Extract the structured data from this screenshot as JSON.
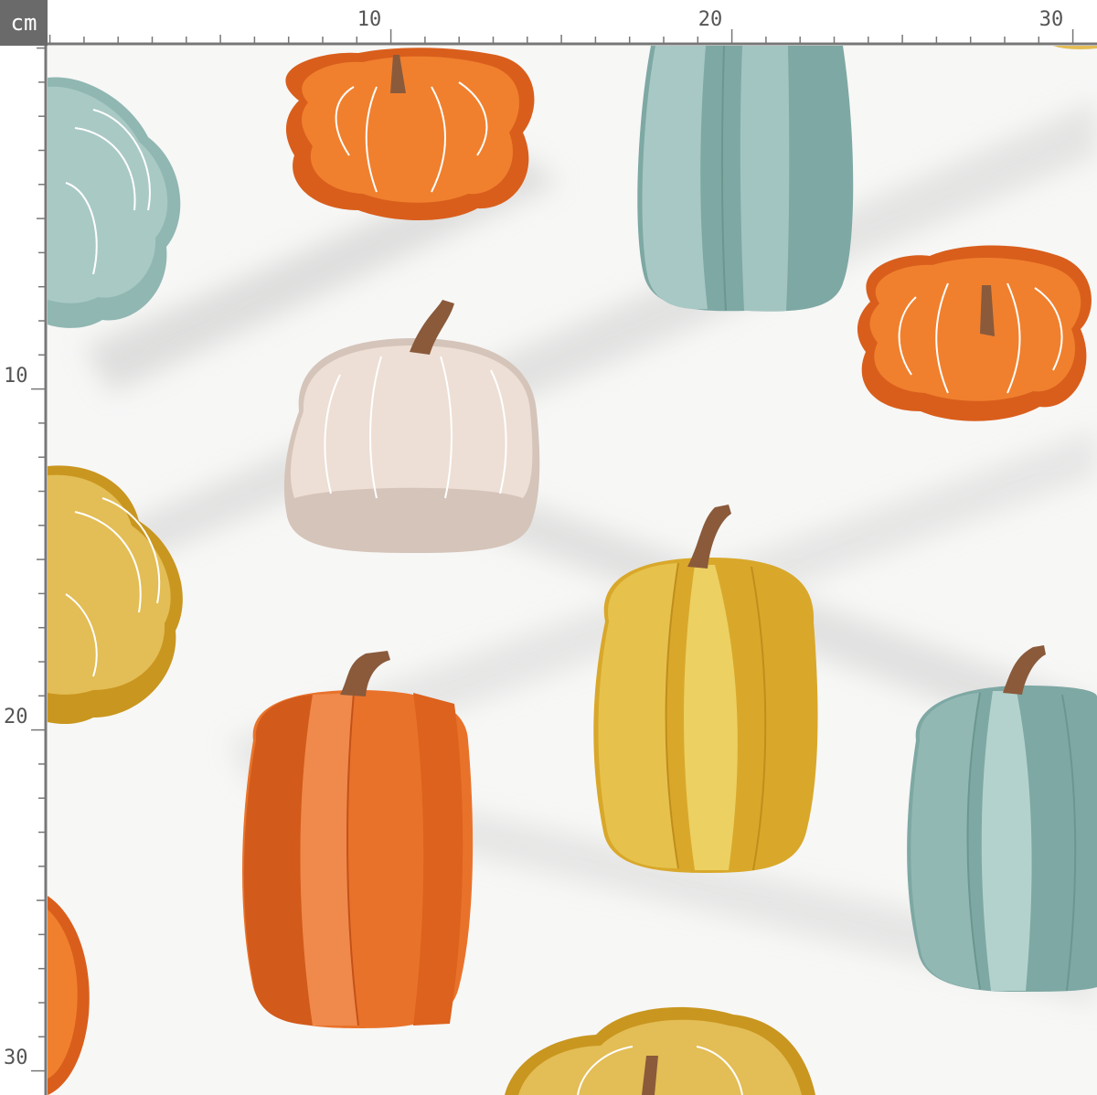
{
  "ruler": {
    "unit_label": "cm",
    "top_labels": [
      "10",
      "20",
      "30"
    ],
    "left_labels": [
      "10",
      "20",
      "30"
    ]
  },
  "colors": {
    "orange": "#ee7a2e",
    "orange_dark": "#cf5a1b",
    "teal": "#8fb5b0",
    "teal_light": "#a9c9c5",
    "mustard": "#e0b33c",
    "mustard_dark": "#c9961f",
    "cream": "#ecdcd2",
    "stem": "#8a5a3b",
    "background": "#f7f7f6"
  },
  "pattern": {
    "motifs": [
      "orange-pumpkin",
      "teal-pumpkin",
      "mustard-pumpkin",
      "cream-pumpkin"
    ]
  }
}
